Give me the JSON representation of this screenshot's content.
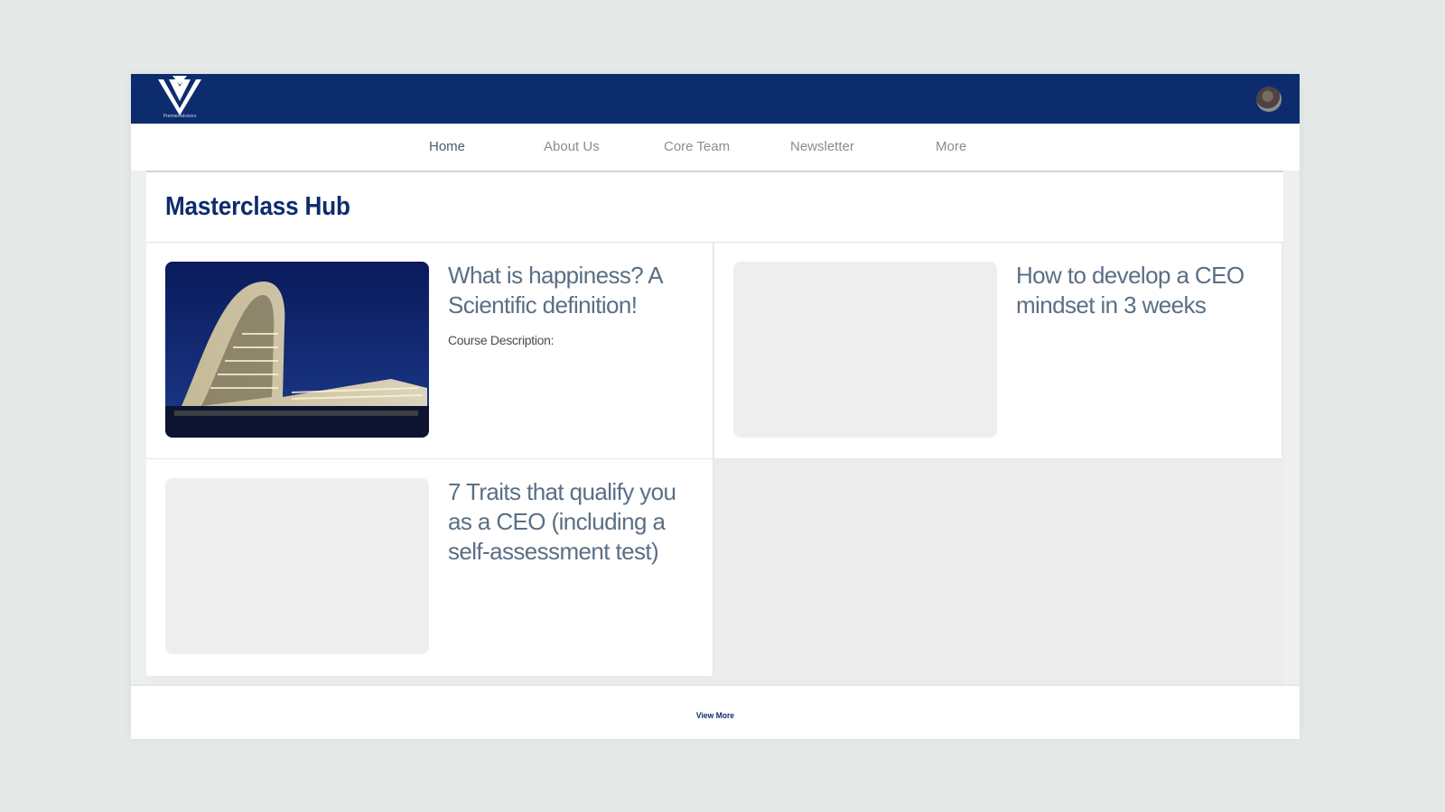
{
  "header": {
    "logo_text": "PremierAdvisors",
    "brand_color": "#0d2c6e",
    "avatar_icon": "user-avatar"
  },
  "nav": {
    "items": [
      {
        "label": "Home",
        "active": true
      },
      {
        "label": "About Us",
        "active": false
      },
      {
        "label": "Core Team",
        "active": false
      },
      {
        "label": "Newsletter",
        "active": false
      },
      {
        "label": "More",
        "active": false
      }
    ]
  },
  "main": {
    "title": "Masterclass Hub",
    "courses": [
      {
        "title": "What is happiness? A Scientific definition!",
        "description": "Course Description:",
        "image": "night-building-photo"
      },
      {
        "title": "How to develop a CEO mindset in 3 weeks",
        "description": "",
        "image": "placeholder"
      },
      {
        "title": "7 Traits that qualify you as a CEO (including a self-assessment test)",
        "description": "",
        "image": "placeholder"
      }
    ]
  },
  "footer": {
    "view_more_label": "View More"
  }
}
